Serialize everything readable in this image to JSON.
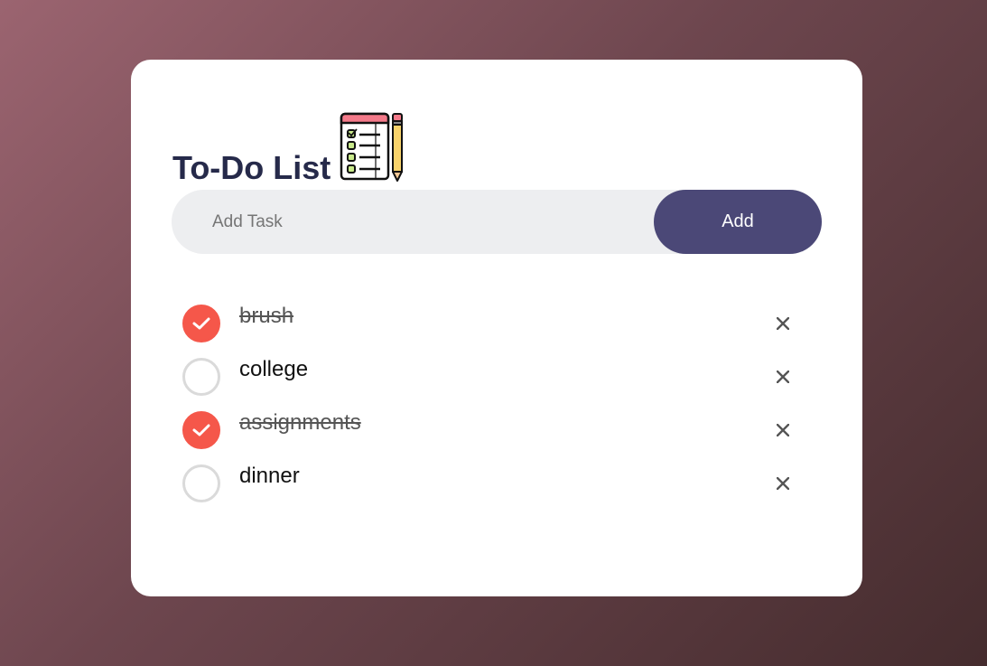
{
  "app": {
    "title": "To-Do List",
    "icon": "checklist-notepad-pencil-icon"
  },
  "input": {
    "placeholder": "Add Task",
    "value": "",
    "add_label": "Add"
  },
  "tasks": [
    {
      "text": "brush",
      "done": true
    },
    {
      "text": "college",
      "done": false
    },
    {
      "text": "assignments",
      "done": true
    },
    {
      "text": "dinner",
      "done": false
    }
  ],
  "colors": {
    "accent": "#f5574a",
    "button": "#4b4877",
    "title": "#262a4a",
    "input_bg": "#edeef0"
  }
}
